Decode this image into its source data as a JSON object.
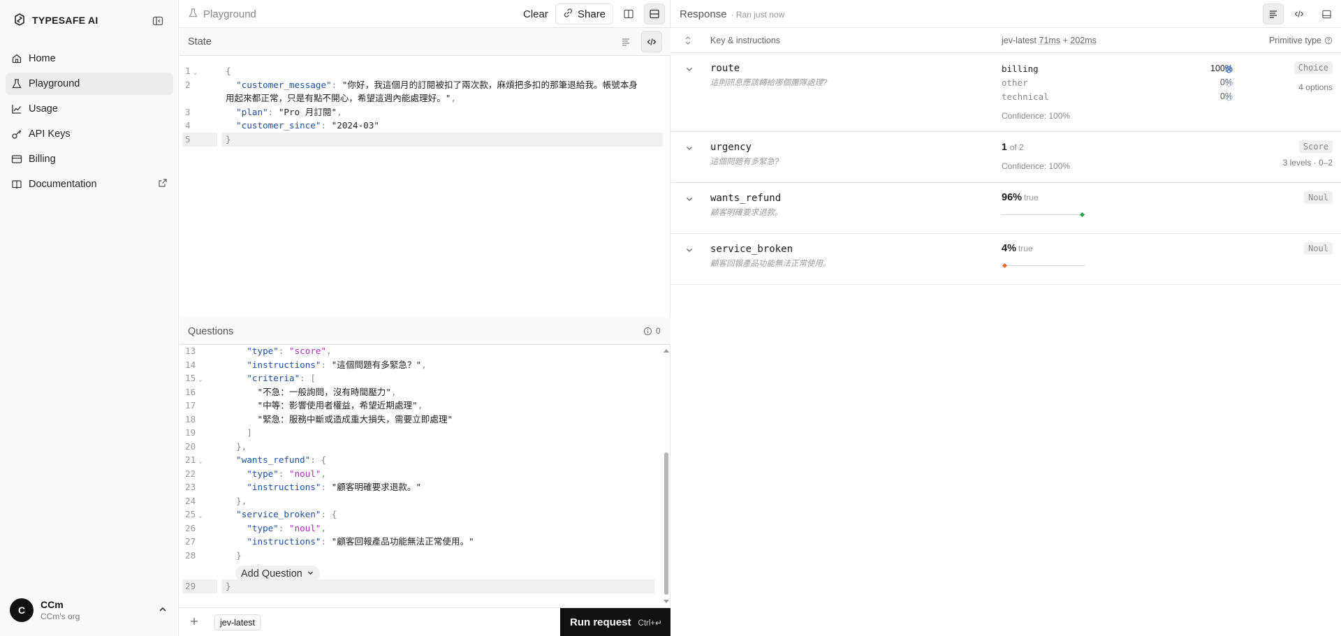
{
  "sidebar": {
    "brand": "TYPESAFE AI",
    "items": [
      {
        "label": "Home",
        "icon": "home-icon",
        "active": false
      },
      {
        "label": "Playground",
        "icon": "flask-icon",
        "active": true
      },
      {
        "label": "Usage",
        "icon": "chart-icon",
        "active": false
      },
      {
        "label": "API Keys",
        "icon": "key-icon",
        "active": false
      },
      {
        "label": "Billing",
        "icon": "credit-card-icon",
        "active": false
      },
      {
        "label": "Documentation",
        "icon": "book-icon",
        "active": false
      }
    ],
    "user": {
      "initial": "C",
      "name": "CCm",
      "org": "CCm's org"
    }
  },
  "playground": {
    "title": "Playground",
    "clear_label": "Clear",
    "share_label": "Share",
    "state": {
      "title": "State",
      "lines": [
        {
          "n": "1",
          "fold": true,
          "text": "{"
        },
        {
          "n": "2",
          "fold": false,
          "text": "  \"customer_message\": \"你好，我這個月的訂閱被扣了兩次款，麻煩把多扣的那筆退給我。帳號本身"
        },
        {
          "n": "",
          "fold": false,
          "text": "用起來都正常，只是有點不開心，希望這週內能處理好。\","
        },
        {
          "n": "3",
          "fold": false,
          "text": "  \"plan\": \"Pro 月訂閱\","
        },
        {
          "n": "4",
          "fold": false,
          "text": "  \"customer_since\": \"2024-03\""
        },
        {
          "n": "5",
          "fold": false,
          "text": "}"
        }
      ]
    },
    "questions": {
      "title": "Questions",
      "issue_count": "0",
      "lines": [
        {
          "n": "13",
          "fold": false,
          "text": "    \"type\": \"score\","
        },
        {
          "n": "14",
          "fold": false,
          "text": "    \"instructions\": \"這個問題有多緊急？\","
        },
        {
          "n": "15",
          "fold": true,
          "text": "    \"criteria\": ["
        },
        {
          "n": "16",
          "fold": false,
          "text": "      \"不急：一般詢問，沒有時間壓力\","
        },
        {
          "n": "17",
          "fold": false,
          "text": "      \"中等：影響使用者權益，希望近期處理\","
        },
        {
          "n": "18",
          "fold": false,
          "text": "      \"緊急：服務中斷或造成重大損失，需要立即處理\""
        },
        {
          "n": "19",
          "fold": false,
          "text": "    ]"
        },
        {
          "n": "20",
          "fold": false,
          "text": "  },"
        },
        {
          "n": "21",
          "fold": true,
          "text": "  \"wants_refund\": {"
        },
        {
          "n": "22",
          "fold": false,
          "text": "    \"type\": \"noul\","
        },
        {
          "n": "23",
          "fold": false,
          "text": "    \"instructions\": \"顧客明確要求退款。\""
        },
        {
          "n": "24",
          "fold": false,
          "text": "  },"
        },
        {
          "n": "25",
          "fold": true,
          "text": "  \"service_broken\": {"
        },
        {
          "n": "26",
          "fold": false,
          "text": "    \"type\": \"noul\","
        },
        {
          "n": "27",
          "fold": false,
          "text": "    \"instructions\": \"顧客回報產品功能無法正常使用。\""
        },
        {
          "n": "28",
          "fold": false,
          "text": "  }"
        }
      ],
      "last_line": {
        "n": "29",
        "text": "}"
      },
      "add_label": "Add Question"
    },
    "footer": {
      "model": "jev-latest",
      "run_label": "Run request",
      "run_shortcut": "Ctrl+↵"
    }
  },
  "response": {
    "title": "Response",
    "subtitle": "· Ran just now",
    "columns": {
      "key": "Key & instructions",
      "model": "jev-latest",
      "t1": "71ms",
      "plus": "+",
      "t2": "202ms",
      "primitive": "Primitive type"
    },
    "rows": {
      "route": {
        "key": "route",
        "instructions": "這則訊息應該轉給哪個團隊處理?",
        "options": [
          {
            "label": "billing",
            "pct": "100%",
            "selected": true
          },
          {
            "label": "other",
            "pct": "0%",
            "selected": false
          },
          {
            "label": "technical",
            "pct": "0%",
            "selected": false
          }
        ],
        "confidence": "Confidence: 100%",
        "type": "Choice",
        "type_sub": "4 options"
      },
      "urgency": {
        "key": "urgency",
        "instructions": "這個問題有多緊急?",
        "value": "1",
        "of": "of 2",
        "confidence": "Confidence: 100%",
        "type": "Score",
        "type_sub": "3 levels · 0–2"
      },
      "wants_refund": {
        "key": "wants_refund",
        "instructions": "顧客明確要求退款。",
        "pct": "96%",
        "val": "true",
        "level": 0.96,
        "color": "#22a447",
        "type": "Noul"
      },
      "service_broken": {
        "key": "service_broken",
        "instructions": "顧客回報產品功能無法正常使用。",
        "pct": "4%",
        "val": "true",
        "level": 0.04,
        "color": "#f06a2a",
        "type": "Noul"
      }
    }
  }
}
